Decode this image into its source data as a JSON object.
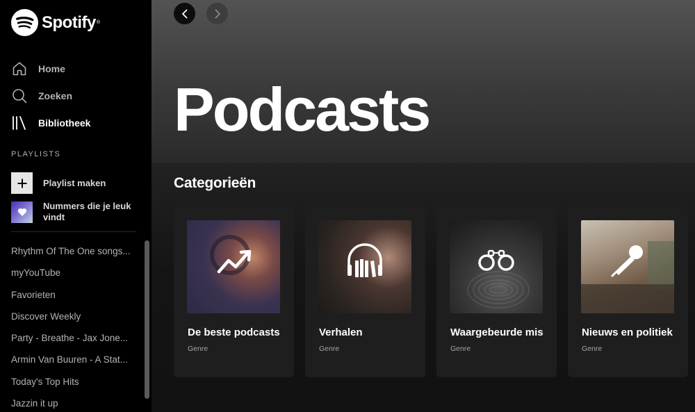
{
  "app": {
    "name": "Spotify"
  },
  "sidebar": {
    "nav": [
      {
        "label": "Home",
        "icon": "home-icon"
      },
      {
        "label": "Zoeken",
        "icon": "search-icon"
      },
      {
        "label": "Bibliotheek",
        "icon": "library-icon"
      }
    ],
    "section_label": "PLAYLISTS",
    "create_playlist": "Playlist maken",
    "liked_songs": "Nummers die je leuk vindt",
    "playlists": [
      "Rhythm Of The One songs...",
      "myYouTube",
      "Favorieten",
      "Discover Weekly",
      "Party - Breathe - Jax Jone...",
      "Armin Van Buuren - A Stat...",
      "Today's Top Hits",
      "Jazzin it up"
    ]
  },
  "main": {
    "title": "Podcasts",
    "section_title": "Categorieën",
    "cards": [
      {
        "title": "De beste podcasts",
        "subtitle": "Genre",
        "icon": "trending-up-icon"
      },
      {
        "title": "Verhalen",
        "subtitle": "Genre",
        "icon": "headphones-books-icon"
      },
      {
        "title": "Waargebeurde misdaad",
        "subtitle": "Genre",
        "icon": "handcuffs-icon"
      },
      {
        "title": "Nieuws en politiek",
        "subtitle": "Genre",
        "icon": "microphone-icon"
      }
    ]
  },
  "colors": {
    "accent": "#1DB954",
    "sidebar_bg": "#000000",
    "main_bg": "#121212"
  }
}
